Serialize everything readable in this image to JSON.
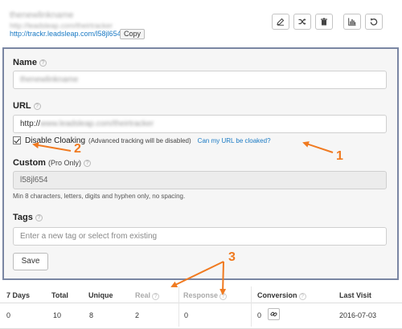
{
  "header": {
    "link_name": "thenewlinkname",
    "source_url": "http://leadsleap.com/theirtracker",
    "tracking_url": "http://trackr.leadsleap.com/l58jl654",
    "copy_label": "Copy"
  },
  "toolbar": {
    "icons": [
      "edit-icon",
      "shuffle-icon",
      "trash-icon",
      "bar-chart-icon",
      "reset-icon"
    ]
  },
  "form": {
    "name_label": "Name",
    "name_value": "thenewlinkname",
    "url_label": "URL",
    "url_prefix": "http://",
    "url_value_hidden": "www.leadsleap.com/theirtracker",
    "disable_cloaking_label": "Disable Cloaking",
    "disable_cloaking_checked": true,
    "disable_cloaking_note": "(Advanced tracking will be disabled)",
    "cloak_link": "Can my URL be cloaked?",
    "custom_label": "Custom",
    "custom_sub": "(Pro Only)",
    "custom_value": "l58jl654",
    "custom_help": "Min 8 characters, letters, digits and hyphen only, no spacing.",
    "tags_label": "Tags",
    "tags_placeholder": "Enter a new tag or select from existing",
    "save_label": "Save"
  },
  "stats": {
    "headers": [
      "7 Days",
      "Total",
      "Unique",
      "Real",
      "Response",
      "Conversion",
      "Last Visit"
    ],
    "values": [
      "0",
      "10",
      "8",
      "2",
      "0",
      "0",
      "2016-07-03"
    ]
  },
  "annotations": {
    "labels": [
      "1",
      "2",
      "3"
    ],
    "color": "#f07a20"
  },
  "colors": {
    "panel_border": "#7a86a3",
    "link": "#1a7ac4",
    "annotation": "#f07a20"
  }
}
